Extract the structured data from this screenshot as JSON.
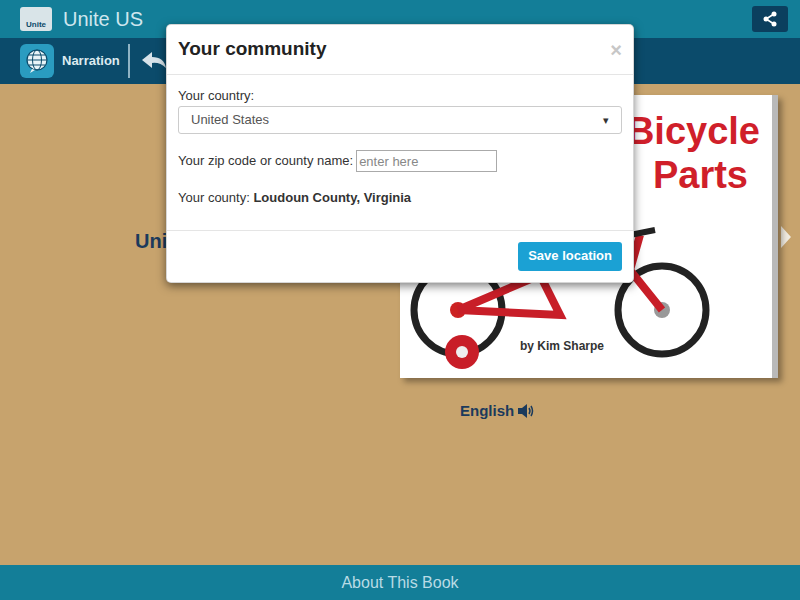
{
  "header": {
    "logo": "Unite",
    "title": "Unite US"
  },
  "toolbar": {
    "narration": "Narration"
  },
  "book": {
    "heading": "Unit",
    "cover_title": [
      "Bicycle",
      "Parts"
    ],
    "author": "by Kim Sharpe",
    "language": "English"
  },
  "footer": {
    "label": "About This Book"
  },
  "modal": {
    "title": "Your community",
    "close": "×",
    "country_label": "Your country:",
    "country": "United States",
    "dropdown_arrow": "▾",
    "zip_label": "Your zip code or county name:",
    "zip_placeholder": "enter here",
    "county_label": "Your county:",
    "county": "Loudoun County, Virginia",
    "save": "Save location"
  }
}
